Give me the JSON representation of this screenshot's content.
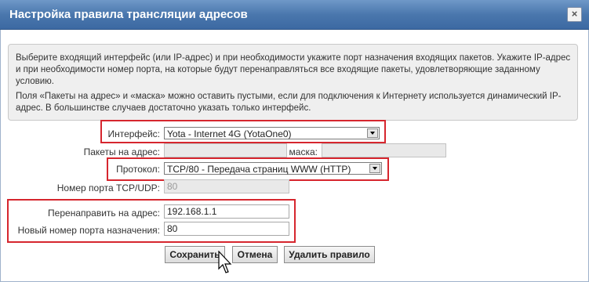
{
  "window": {
    "title": "Настройка правила трансляции адресов",
    "close_glyph": "×"
  },
  "info": {
    "paragraph1": "Выберите входящий интерфейс (или IP-адрес) и при необходимости укажите порт назначения входящих пакетов. Укажите IP-адрес и при необходимости номер порта, на которые будут перенаправляться все входящие пакеты, удовлетворяющие заданному условию.",
    "paragraph2": "Поля «Пакеты на адрес» и «маска» можно оставить пустыми, если для подключения к Интернету используется динамический IP-адрес. В большинстве случаев достаточно указать только интерфейс."
  },
  "form": {
    "interface_label": "Интерфейс:",
    "interface_value": "Yota - Internet 4G (YotaOne0)",
    "packets_label": "Пакеты на адрес:",
    "packets_value": "",
    "mask_label": "маска:",
    "mask_value": "",
    "protocol_label": "Протокол:",
    "protocol_value": "TCP/80 - Передача страниц WWW (HTTP)",
    "port_label": "Номер порта TCP/UDP:",
    "port_value": "80",
    "redirect_label": "Перенаправить на адрес:",
    "redirect_value": "192.168.1.1",
    "new_port_label": "Новый номер порта назначения:",
    "new_port_value": "80"
  },
  "buttons": {
    "save": "Сохранить",
    "cancel": "Отмена",
    "delete": "Удалить правило"
  },
  "colors": {
    "titlebar": "#4a77ad",
    "highlight_box": "#d6262e"
  }
}
